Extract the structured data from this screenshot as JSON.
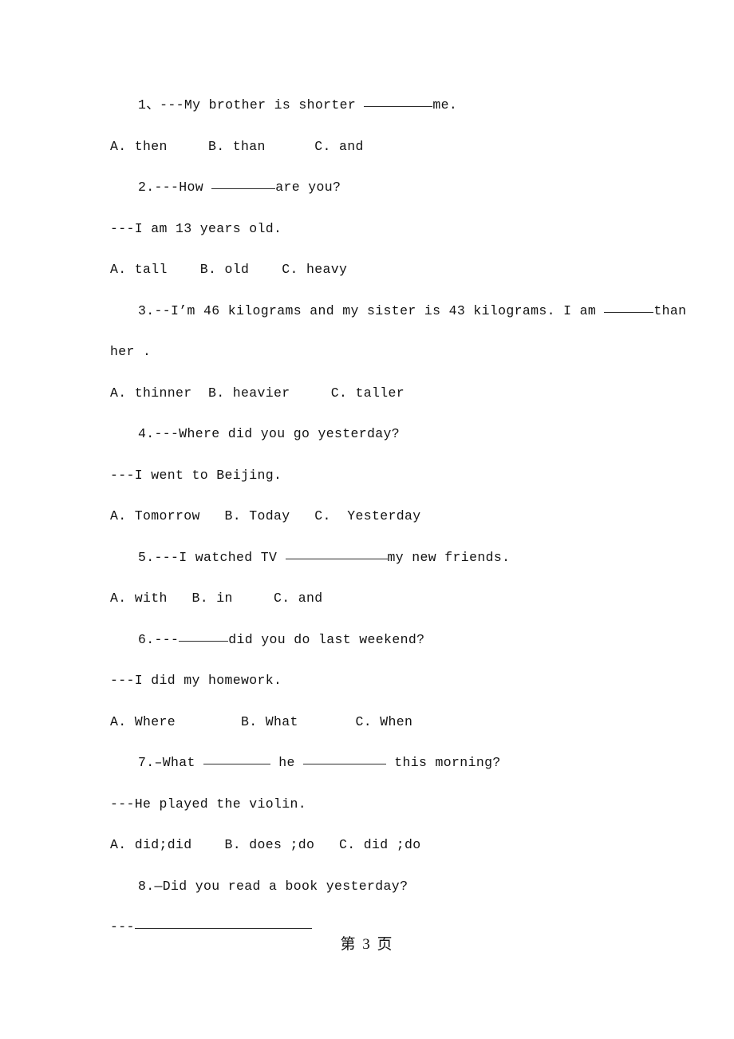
{
  "page": {
    "footer_label": "第 3 页",
    "page_number": "3",
    "background_color": "#ffffff",
    "text_color": "#121212"
  },
  "questions": [
    {
      "number": "1、",
      "prompt_before": "---My brother is shorter ",
      "blank_width": 86,
      "prompt_after": "me.",
      "answer_line": null,
      "options_text": "A. then     B. than      C. and"
    },
    {
      "number": "2.",
      "prompt_before": "---How ",
      "blank_width": 80,
      "prompt_after": "are you?",
      "answer_line": "---I am 13 years old.",
      "options_text": "A. tall    B. old    C. heavy"
    },
    {
      "number": "3.",
      "prompt_before": "--I’m 46 kilograms and my sister is 43 kilograms. I am ",
      "blank_width": 62,
      "prompt_after": "than",
      "wrap_line": "her .",
      "answer_line": null,
      "options_text": "A. thinner  B. heavier     C. taller"
    },
    {
      "number": "4.",
      "prompt_before": "---Where did you go yesterday?",
      "blank_width": 0,
      "prompt_after": "",
      "answer_line": "---I went to Beijing.",
      "options_text": "A. Tomorrow   B. Today   C.  Yesterday"
    },
    {
      "number": "5.",
      "prompt_before": "---I watched TV ",
      "blank_width": 128,
      "prompt_after": "my new friends.",
      "answer_line": null,
      "options_text": "A. with   B. in     C. and"
    },
    {
      "number": "6.",
      "prompt_before": "---",
      "blank_width": 62,
      "prompt_after": "did you do last weekend?",
      "answer_line": "---I did my homework.",
      "options_text": "A. Where        B. What       C. When"
    },
    {
      "number": "7.",
      "prompt_before": "–What ",
      "blank_width": 84,
      "prompt_middle": " he ",
      "blank_width_2": 104,
      "prompt_after": " this morning?",
      "answer_line": "---He played the violin.",
      "options_text": "A. did;did    B. does ;do   C. did ;do"
    },
    {
      "number": "8.",
      "prompt_before": "—Did you read a book yesterday?",
      "blank_width": 0,
      "prompt_after": "",
      "answer_line_prefix": "---",
      "answer_blank_width": 222,
      "options_text": null
    }
  ]
}
